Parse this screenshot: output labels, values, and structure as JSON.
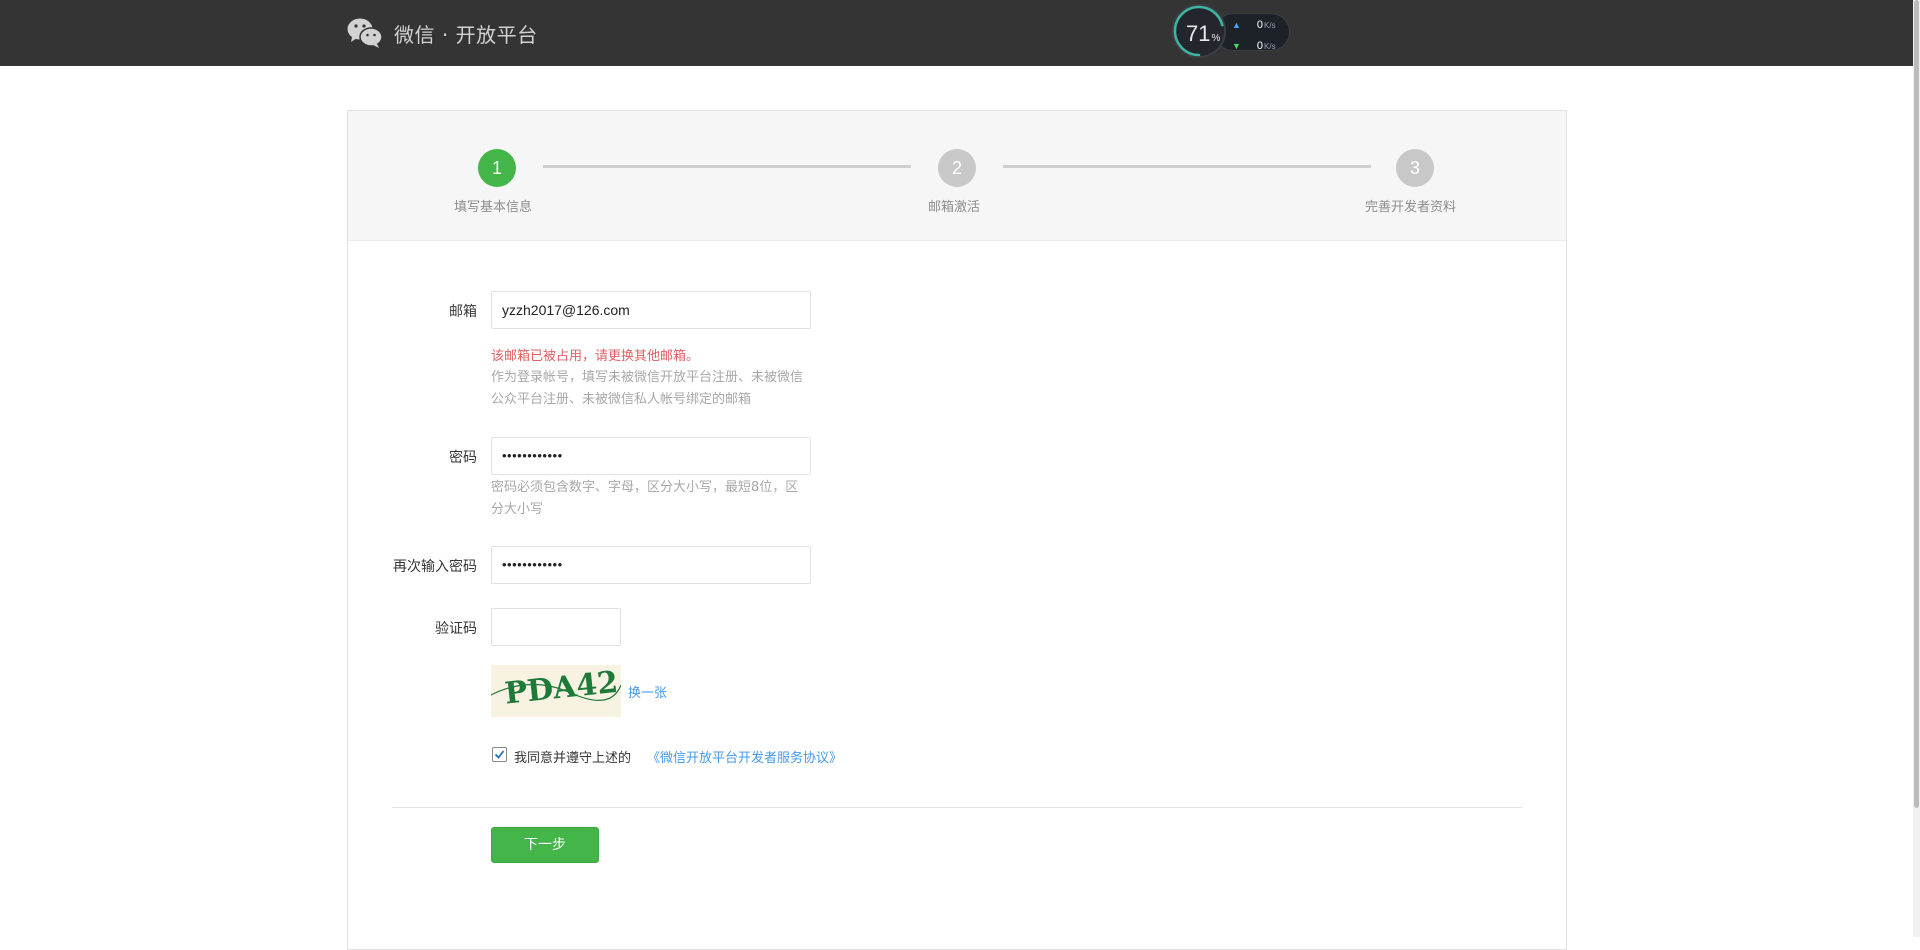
{
  "header": {
    "title": "微信 · 开放平台",
    "logo_icon": "wechat-logo-icon"
  },
  "speed_widget": {
    "percent": "71",
    "percent_unit": "%",
    "up_value": "0",
    "down_value": "0",
    "unit": "K/s",
    "percent_value": 71
  },
  "steps": [
    {
      "number": "1",
      "label": "填写基本信息",
      "active": true
    },
    {
      "number": "2",
      "label": "邮箱激活",
      "active": false
    },
    {
      "number": "3",
      "label": "完善开发者资料",
      "active": false
    }
  ],
  "form": {
    "email": {
      "label": "邮箱",
      "value": "yzzh2017@126.com",
      "error": "该邮箱已被占用，请更换其他邮箱。",
      "hint": "作为登录帐号，填写未被微信开放平台注册、未被微信公众平台注册、未被微信私人帐号绑定的邮箱"
    },
    "password": {
      "label": "密码",
      "value": "••••••••••••",
      "hint": "密码必须包含数字、字母，区分大小写，最短8位，区分大小写"
    },
    "confirm_password": {
      "label": "再次输入密码",
      "value": "••••••••••••"
    },
    "captcha": {
      "label": "验证码",
      "value": "",
      "image_text": "PDA42",
      "refresh_label": "换一张"
    },
    "agreement": {
      "checked": true,
      "text": "我同意并遵守上述的",
      "link": "《微信开放平台开发者服务协议》"
    },
    "next_button": "下一步"
  },
  "colors": {
    "header_bg": "#343434",
    "accent_green": "#44b549",
    "error_red": "#e15f63",
    "link_blue": "#459ae9"
  }
}
